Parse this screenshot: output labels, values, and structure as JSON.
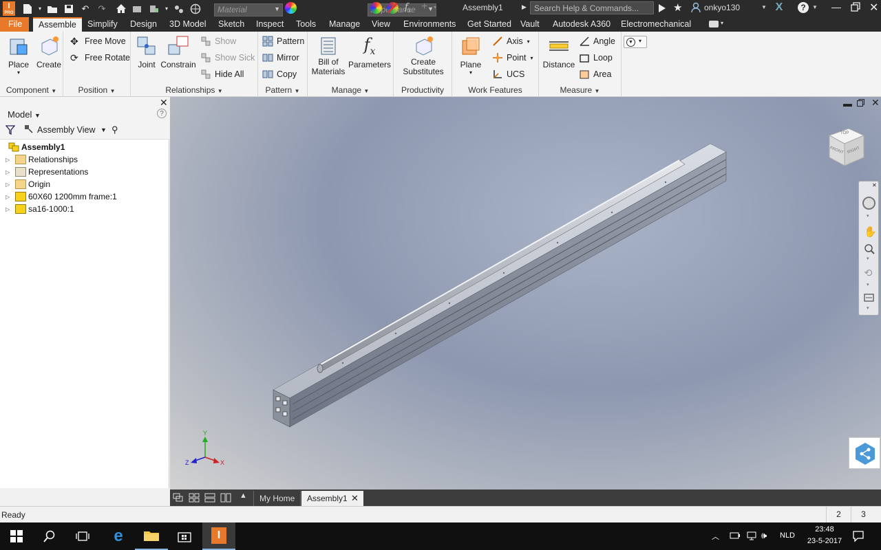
{
  "titlebar": {
    "material_placeholder": "Material",
    "appearance_placeholder": "Appearance",
    "doc_title": "Assembly1",
    "search_placeholder": "Search Help & Commands...",
    "user": "onkyo130"
  },
  "menu_tabs": [
    "File",
    "Assemble",
    "Simplify",
    "Design",
    "3D Model",
    "Sketch",
    "Inspect",
    "Tools",
    "Manage",
    "View",
    "Environments",
    "Get Started",
    "Vault",
    "Autodesk A360",
    "Electromechanical"
  ],
  "active_tab": "Assemble",
  "ribbon": {
    "component": {
      "title": "Component",
      "place": "Place",
      "create": "Create"
    },
    "position": {
      "title": "Position",
      "free_move": "Free Move",
      "free_rotate": "Free Rotate"
    },
    "relationships": {
      "title": "Relationships",
      "joint": "Joint",
      "constrain": "Constrain",
      "show": "Show",
      "show_sick": "Show Sick",
      "hide_all": "Hide All"
    },
    "pattern": {
      "title": "Pattern",
      "pattern": "Pattern",
      "mirror": "Mirror",
      "copy": "Copy"
    },
    "manage": {
      "title": "Manage",
      "bom_line1": "Bill of",
      "bom_line2": "Materials",
      "parameters": "Parameters"
    },
    "productivity": {
      "title": "Productivity",
      "line1": "Create",
      "line2": "Substitutes"
    },
    "work_features": {
      "title": "Work Features",
      "plane": "Plane",
      "axis": "Axis",
      "point": "Point",
      "ucs": "UCS"
    },
    "measure": {
      "title": "Measure",
      "distance": "Distance",
      "angle": "Angle",
      "loop": "Loop",
      "area": "Area"
    }
  },
  "model_panel": {
    "title": "Model",
    "view_mode": "Assembly View",
    "root": "Assembly1",
    "items": [
      {
        "label": "Relationships",
        "icon": "folder-icon"
      },
      {
        "label": "Representations",
        "icon": "representations-icon"
      },
      {
        "label": "Origin",
        "icon": "folder-icon"
      },
      {
        "label": "60X60 1200mm frame:1",
        "icon": "part-icon"
      },
      {
        "label": "sa16-1000:1",
        "icon": "part-icon"
      }
    ]
  },
  "viewcube": {
    "top": "TOP",
    "front": "FRONT",
    "right": "RIGHT"
  },
  "triad": {
    "x": "X",
    "y": "Y",
    "z": "Z"
  },
  "doc_tabs": {
    "home": "My Home",
    "assembly": "Assembly1"
  },
  "status": {
    "text": "Ready",
    "count1": "2",
    "count2": "3"
  },
  "taskbar": {
    "lang": "NLD",
    "time": "23:48",
    "date": "23-5-2017"
  },
  "colors": {
    "file_tab": "#e8792b",
    "accent": "#e8792b",
    "titlebar": "#2b2b2b"
  }
}
